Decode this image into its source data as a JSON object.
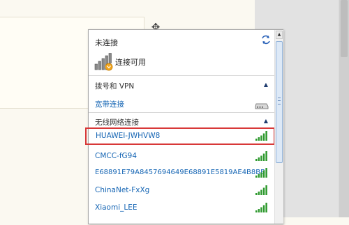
{
  "popup": {
    "status_title": "未连接",
    "refresh_icon": "refresh-icon",
    "available_label": "连接可用",
    "dialup": {
      "header": "拨号和 VPN",
      "items": [
        {
          "label": "宽带连接",
          "icon": "modem-icon"
        }
      ]
    },
    "wireless": {
      "header": "无线网络连接",
      "networks": [
        {
          "name": "HUAWEI-JWHVW8",
          "signal_bars": 5,
          "selected": true
        },
        {
          "name": "CMCC-fG94",
          "signal_bars": 5
        },
        {
          "name": "E68891E79A8457694649E68891E5819AE4B8BB",
          "signal_bars": 5
        },
        {
          "name": "ChinaNet-FxXg",
          "signal_bars": 5
        },
        {
          "name": "Xiaomi_LEE",
          "signal_bars": 5
        }
      ]
    }
  },
  "colors": {
    "link": "#1565b4",
    "highlight_border": "#d83838",
    "signal_green": "#2f9a2f"
  }
}
